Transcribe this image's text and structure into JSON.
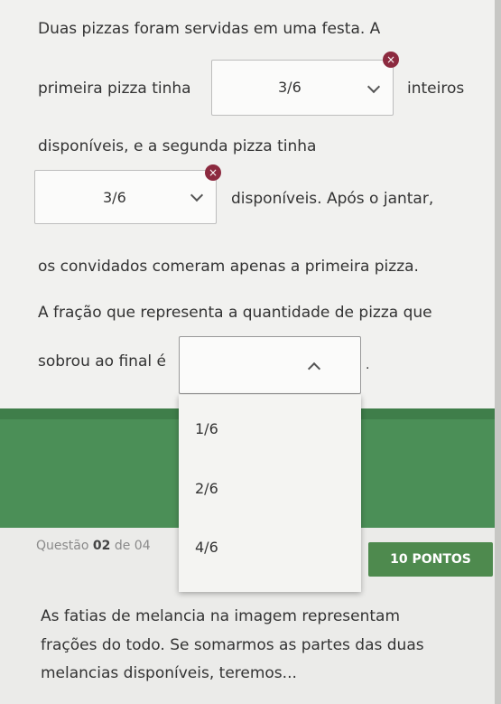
{
  "question1": {
    "line1": "Duas pizzas foram servidas em uma festa. A",
    "line2_prefix": "primeira pizza tinha",
    "select1_value": "3/6",
    "line2_suffix": "inteiros",
    "line3": "disponíveis, e a segunda pizza tinha",
    "select2_value": "3/6",
    "line4_suffix": "disponíveis. Após o jantar,",
    "line5": "os convidados comeram apenas a primeira pizza.",
    "line6": "A fração que representa a quantidade de pizza que",
    "line7_prefix": "sobrou ao final é",
    "select3_value": "",
    "period": ".",
    "dropdown_options": [
      "1/6",
      "2/6",
      "4/6"
    ],
    "wrong_mark": "×"
  },
  "question2": {
    "label_prefix": "Questão",
    "number": "02",
    "label_mid": "de",
    "total": "04",
    "points": "10 PONTOS",
    "line1": "As fatias de melancia na imagem representam",
    "line2": "frações do todo. Se somarmos as partes das duas",
    "line3": "melancias disponíveis, teremos..."
  }
}
